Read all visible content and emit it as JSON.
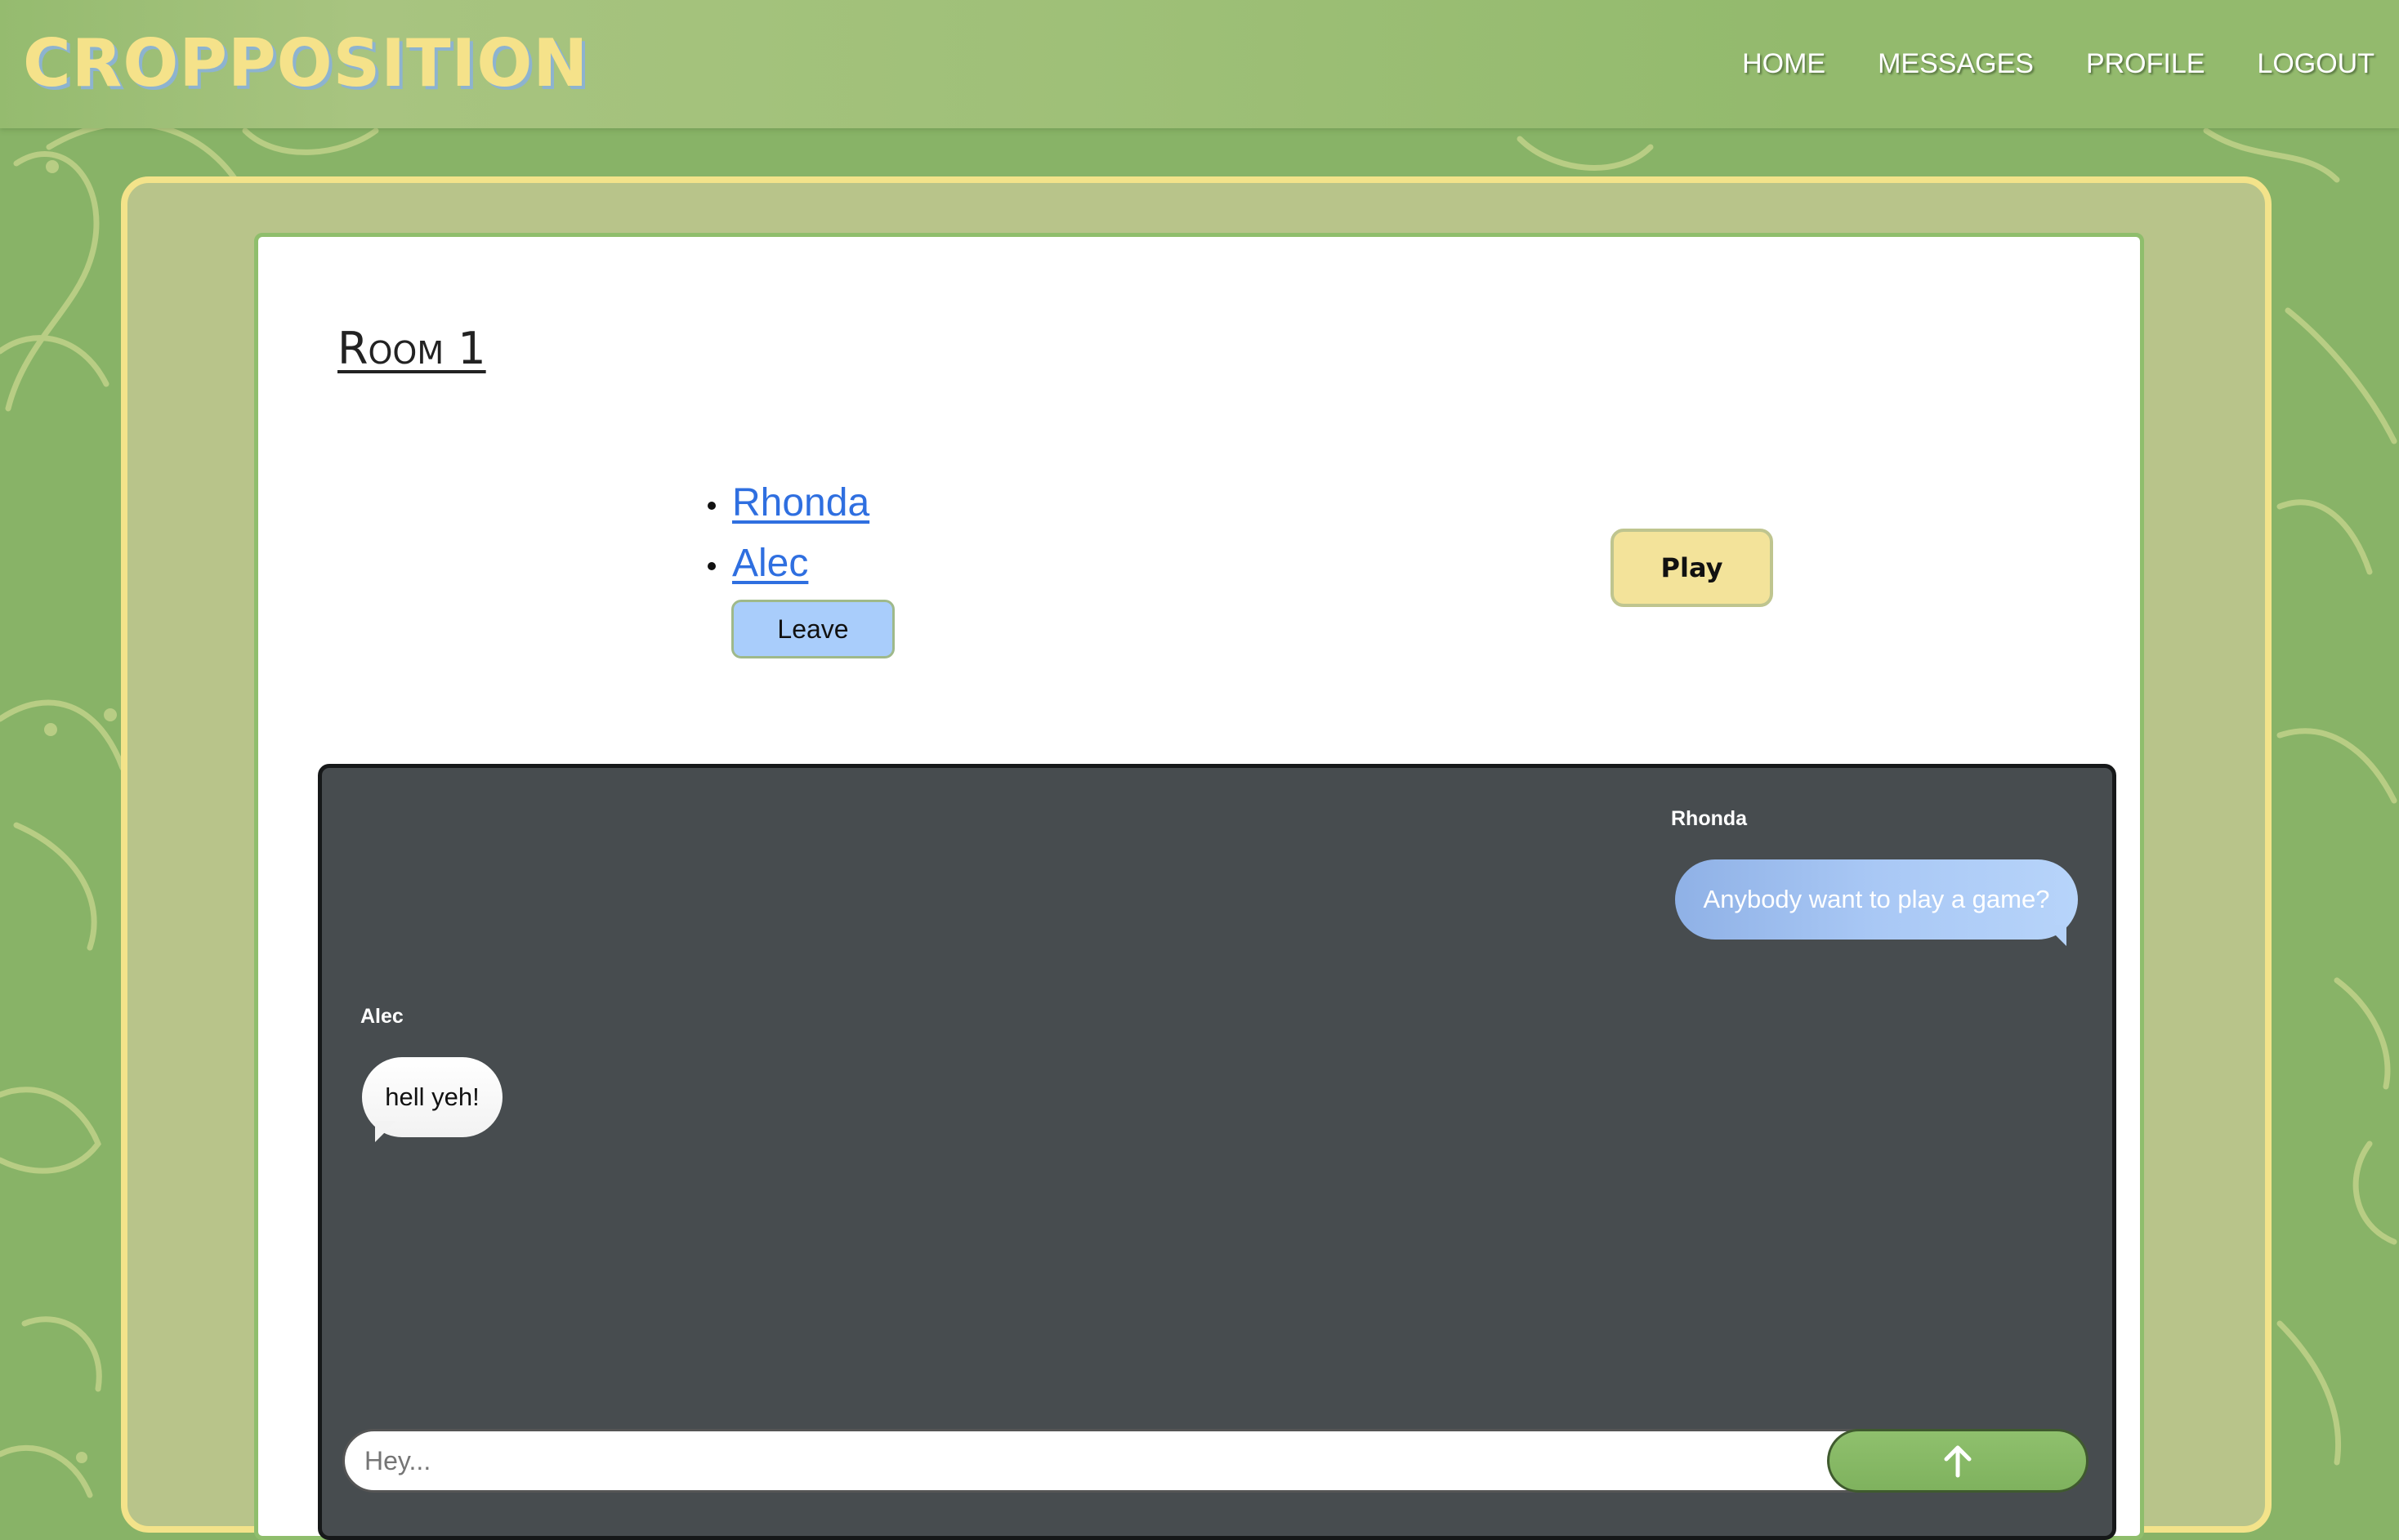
{
  "header": {
    "brand": "CROPPOSITION",
    "nav": [
      {
        "label": "HOME"
      },
      {
        "label": "MESSAGES"
      },
      {
        "label": "PROFILE"
      },
      {
        "label": "LOGOUT"
      }
    ]
  },
  "room": {
    "title": "Room 1",
    "members": [
      {
        "name": "Rhonda"
      },
      {
        "name": "Alec"
      }
    ],
    "leave_label": "Leave",
    "play_label": "Play"
  },
  "chat": {
    "messages": [
      {
        "sender": "Rhonda",
        "text": "Anybody want to play a game?",
        "side": "right"
      },
      {
        "sender": "Alec",
        "text": "hell yeh!",
        "side": "left"
      }
    ],
    "input_placeholder": "Hey...",
    "input_value": "",
    "send_icon": "arrow-up-icon"
  },
  "colors": {
    "background": "#88b367",
    "brand": "#f5e28a",
    "panel": "#b8c48a",
    "chat_bg": "#474c4f",
    "link": "#2f6fe0",
    "send_button": "#86b964",
    "leave_button": "#a9cdfb",
    "play_button": "#f3e39a"
  }
}
